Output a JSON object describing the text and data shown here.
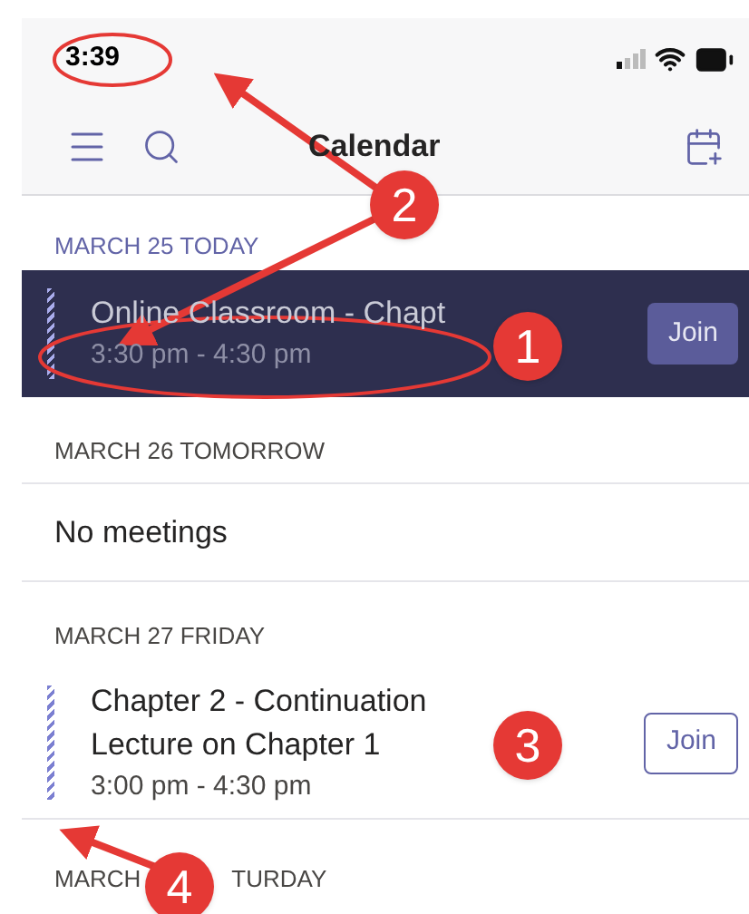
{
  "status_bar": {
    "time": "3:39"
  },
  "header": {
    "title": "Calendar"
  },
  "days": [
    {
      "heading": "MARCH 25 TODAY",
      "events": [
        {
          "title": [
            "Online Classroom - Chapt"
          ],
          "time": "3:30 pm - 4:30 pm",
          "button": "Join",
          "selected": true
        }
      ]
    },
    {
      "heading": "MARCH 26 TOMORROW",
      "empty_text": "No meetings"
    },
    {
      "heading": "MARCH 27 FRIDAY",
      "events": [
        {
          "title": [
            "Chapter 2 - Continuation",
            "Lecture on Chapter 1"
          ],
          "time": "3:00 pm - 4:30 pm",
          "button": "Join",
          "selected": false
        }
      ]
    },
    {
      "heading": "MARCH",
      "heading_tail": "TURDAY"
    }
  ],
  "annotations": [
    {
      "label": "1"
    },
    {
      "label": "2"
    },
    {
      "label": "3"
    },
    {
      "label": "4"
    }
  ]
}
